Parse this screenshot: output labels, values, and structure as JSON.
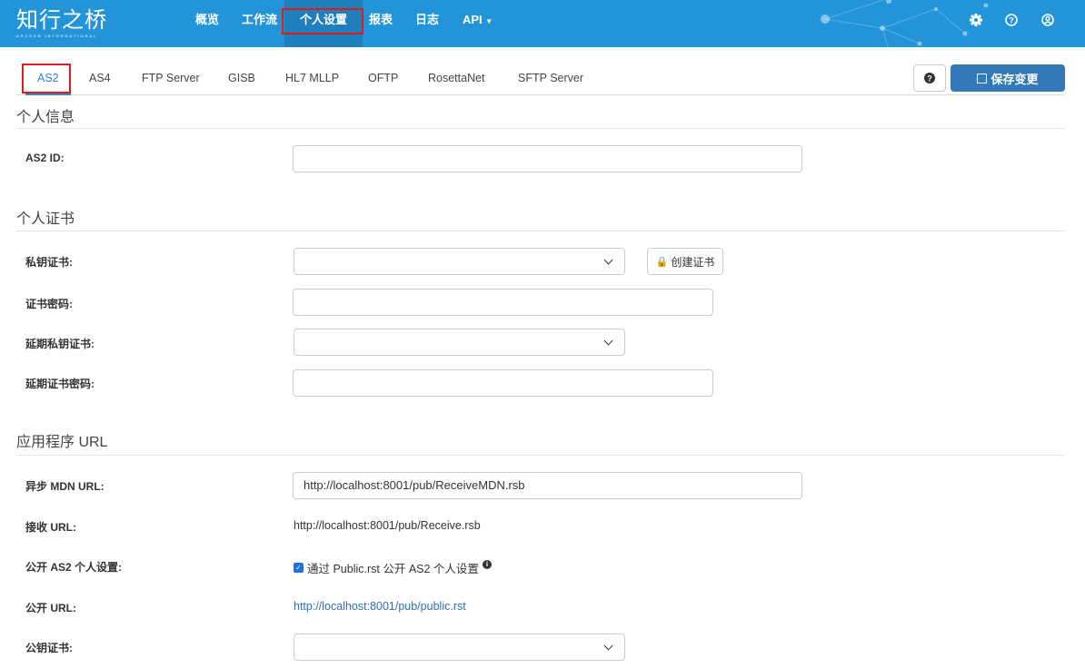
{
  "header": {
    "logo": "知行之桥",
    "logo_sub": "ARCESB INTERNATIONAL",
    "nav": [
      "概览",
      "工作流",
      "个人设置",
      "报表",
      "日志",
      "API"
    ],
    "active_nav": "个人设置"
  },
  "tabs": [
    "AS2",
    "AS4",
    "FTP Server",
    "GISB",
    "HL7 MLLP",
    "OFTP",
    "RosettaNet",
    "SFTP Server"
  ],
  "toolbar": {
    "save_label": "保存变更"
  },
  "sections": {
    "info": {
      "title": "个人信息",
      "as2_id_label": "AS2 ID:",
      "as2_id_value": ""
    },
    "cert": {
      "title": "个人证书",
      "private_cert_label": "私钥证书:",
      "create_cert_label": "创建证书",
      "cert_password_label": "证书密码:",
      "deferred_cert_label": "延期私钥证书:",
      "deferred_password_label": "延期证书密码:"
    },
    "url": {
      "title": "应用程序 URL",
      "async_mdn_label": "异步 MDN URL:",
      "async_mdn_value": "http://localhost:8001/pub/ReceiveMDN.rsb",
      "receive_label": "接收 URL:",
      "receive_value": "http://localhost:8001/pub/Receive.rsb",
      "public_profile_label": "公开 AS2 个人设置:",
      "public_profile_checkbox": "通过 Public.rst 公开 AS2 个人设置",
      "public_profile_checked": true,
      "public_url_label": "公开 URL:",
      "public_url_value": "http://localhost:8001/pub/public.rst",
      "public_cert_label": "公钥证书:"
    }
  },
  "colors": {
    "header": "#2394d8",
    "accent": "#2f87d0",
    "save": "#3379b7",
    "highlight": "#e01b1b"
  }
}
